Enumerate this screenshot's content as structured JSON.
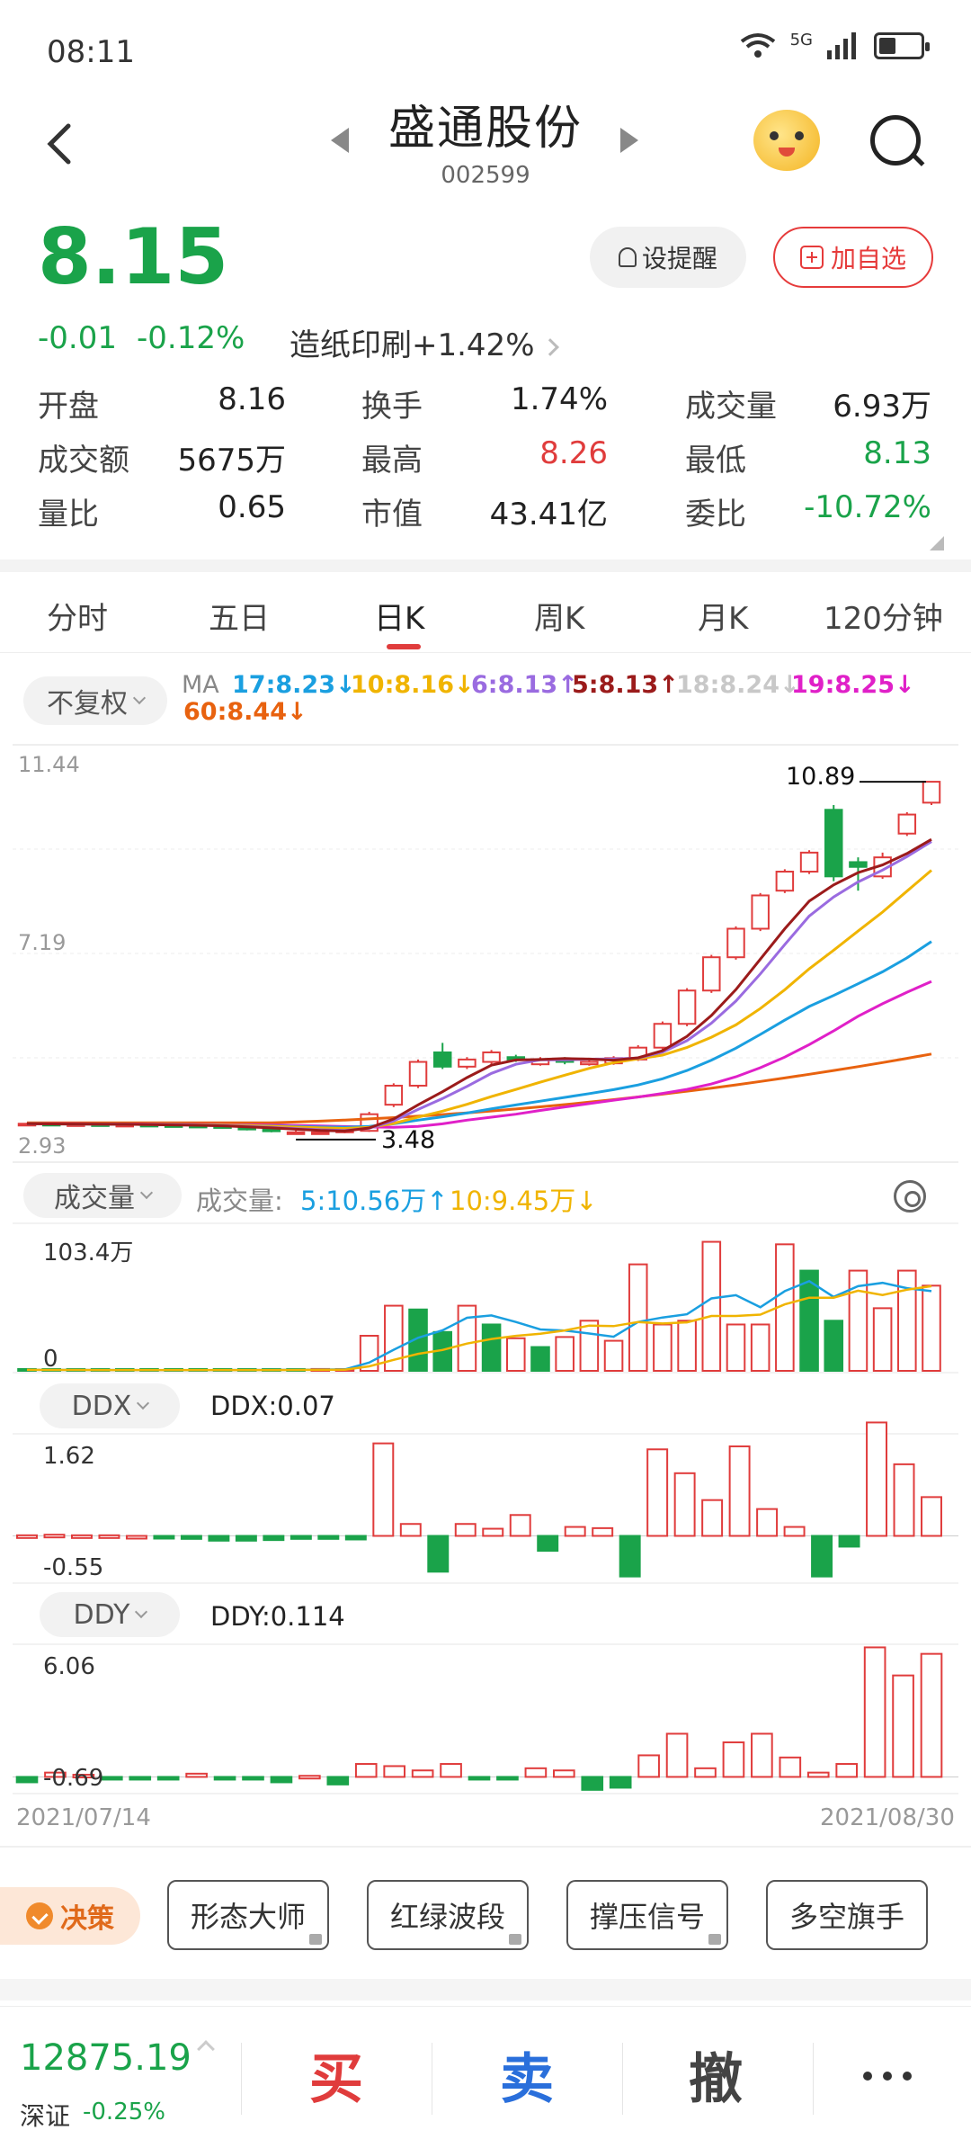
{
  "status": {
    "time": "08:11",
    "network": "5G"
  },
  "header": {
    "title": "盛通股份",
    "code": "002599"
  },
  "quote": {
    "price": "8.15",
    "change": "-0.01",
    "change_pct": "-0.12%",
    "sector_name": "造纸印刷",
    "sector_pct": "+1.42%",
    "remind_label": "设提醒",
    "add_label": "加自选",
    "stats": [
      {
        "label": "开盘",
        "value": "8.16"
      },
      {
        "label": "换手",
        "value": "1.74%"
      },
      {
        "label": "成交量",
        "value": "6.93万"
      },
      {
        "label": "成交额",
        "value": "5675万"
      },
      {
        "label": "最高",
        "value": "8.26"
      },
      {
        "label": "最低",
        "value": "8.13"
      },
      {
        "label": "量比",
        "value": "0.65"
      },
      {
        "label": "市值",
        "value": "43.41亿"
      },
      {
        "label": "委比",
        "value": "-10.72%"
      }
    ]
  },
  "tabs": [
    "分时",
    "五日",
    "日K",
    "周K",
    "月K",
    "120分钟"
  ],
  "kline": {
    "adjust_label": "不复权",
    "ma": [
      {
        "text": "MA",
        "color": "#888888"
      },
      {
        "text": "17:8.23↓",
        "color": "#1a9fe0"
      },
      {
        "text": "10:8.16↓",
        "color": "#f0b400"
      },
      {
        "text": "6:8.13↑",
        "color": "#9a6be0"
      },
      {
        "text": "5:8.13↑",
        "color": "#9b1b1b"
      },
      {
        "text": "18:8.24↓",
        "color": "#c8c8c8"
      },
      {
        "text": "19:8.25↓",
        "color": "#e020c8"
      },
      {
        "text": "60:8.44↓",
        "color": "#e8620f"
      }
    ],
    "y_top": "11.44",
    "y_mid": "7.19",
    "y_bot": "2.93",
    "high_mark": "10.89",
    "low_mark": "3.48"
  },
  "volume": {
    "pill": "成交量",
    "label": "成交量:",
    "ma5": "5:10.56万↑",
    "ma10": "10:9.45万↓",
    "y_top": "103.4万",
    "y_bot": "0"
  },
  "ddx": {
    "pill": "DDX",
    "value_label": "DDX:0.07",
    "y_top": "1.62",
    "y_bot": "-0.55"
  },
  "ddy": {
    "pill": "DDY",
    "value_label": "DDY:0.114",
    "y_top": "6.06",
    "y_bot": "-0.69"
  },
  "dates": {
    "start": "2021/07/14",
    "end": "2021/08/30"
  },
  "tools": {
    "decide": "决策",
    "items": [
      "形态大师",
      "红绿波段",
      "撑压信号",
      "多空旗手"
    ]
  },
  "bottom": {
    "index_value": "12875.19",
    "index_name": "深证",
    "index_change": "-0.25%",
    "buy": "买",
    "sell": "卖",
    "cancel": "撤"
  },
  "chart_data": [
    {
      "type": "candlestick",
      "title": "日K",
      "ylim": [
        2.93,
        11.44
      ],
      "x_range": [
        "2021/07/14",
        "2021/08/30"
      ],
      "open": [
        3.7,
        3.7,
        3.69,
        3.69,
        3.68,
        3.68,
        3.67,
        3.66,
        3.65,
        3.62,
        3.58,
        3.52,
        3.5,
        3.52,
        3.55,
        4.1,
        4.5,
        5.2,
        4.9,
        5.0,
        5.1,
        4.95,
        5.05,
        4.95,
        4.97,
        5.05,
        5.3,
        5.8,
        6.5,
        7.2,
        7.8,
        8.6,
        9.0,
        10.3,
        9.2,
        8.9,
        9.8,
        10.45
      ],
      "close": [
        3.7,
        3.69,
        3.69,
        3.68,
        3.68,
        3.67,
        3.66,
        3.65,
        3.62,
        3.58,
        3.55,
        3.52,
        3.52,
        3.56,
        3.9,
        4.5,
        5.0,
        4.9,
        5.05,
        5.2,
        5.05,
        5.05,
        5.0,
        5.0,
        5.08,
        5.3,
        5.8,
        6.5,
        7.2,
        7.8,
        8.5,
        9.0,
        9.4,
        8.9,
        9.1,
        9.3,
        10.2,
        10.89
      ],
      "high": [
        3.72,
        3.71,
        3.7,
        3.7,
        3.69,
        3.69,
        3.68,
        3.67,
        3.66,
        3.63,
        3.6,
        3.56,
        3.54,
        3.6,
        3.95,
        4.55,
        5.05,
        5.4,
        5.1,
        5.25,
        5.15,
        5.1,
        5.1,
        5.05,
        5.12,
        5.35,
        5.85,
        6.55,
        7.25,
        7.85,
        8.55,
        9.05,
        9.45,
        10.4,
        9.3,
        9.4,
        10.25,
        10.89
      ],
      "low": [
        3.68,
        3.68,
        3.67,
        3.67,
        3.66,
        3.66,
        3.65,
        3.64,
        3.6,
        3.56,
        3.52,
        3.48,
        3.49,
        3.5,
        3.53,
        4.05,
        4.45,
        4.85,
        4.85,
        4.95,
        5.0,
        4.92,
        4.95,
        4.92,
        4.94,
        5.02,
        5.25,
        5.75,
        6.45,
        7.15,
        7.75,
        8.55,
        8.95,
        8.8,
        8.6,
        8.85,
        9.75,
        10.4
      ]
    },
    {
      "type": "bar",
      "title": "成交量",
      "ylim": [
        0,
        103.4
      ],
      "unit": "万",
      "values": [
        0.8,
        0.7,
        0.6,
        0.6,
        0.5,
        0.6,
        0.6,
        0.5,
        0.7,
        0.8,
        1.0,
        1.1,
        1.5,
        1.4,
        28,
        52,
        49,
        31,
        52,
        37,
        26,
        19,
        27,
        40,
        24,
        85,
        37,
        40,
        103,
        37,
        37,
        101,
        80,
        40,
        80,
        50,
        80,
        68
      ],
      "up": [
        0,
        0,
        0,
        0,
        0,
        0,
        0,
        0,
        0,
        0,
        0,
        0,
        1,
        1,
        1,
        1,
        0,
        0,
        1,
        0,
        1,
        0,
        1,
        1,
        1,
        1,
        1,
        1,
        1,
        1,
        1,
        1,
        0,
        0,
        1,
        1,
        1,
        1
      ]
    },
    {
      "type": "bar",
      "title": "DDX",
      "ylim": [
        -0.55,
        1.62
      ],
      "values": [
        0.01,
        0.02,
        0.01,
        0.01,
        0,
        -0.02,
        -0.05,
        -0.08,
        -0.08,
        -0.07,
        -0.05,
        -0.05,
        -0.06,
        1.55,
        0.2,
        -0.6,
        0.2,
        0.12,
        0.35,
        -0.25,
        0.15,
        0.13,
        -0.68,
        1.45,
        1.05,
        0.6,
        1.5,
        0.45,
        0.15,
        -0.68,
        -0.18,
        1.9,
        1.2,
        0.65
      ],
      "up": [
        1,
        1,
        1,
        1,
        1,
        0,
        0,
        0,
        0,
        0,
        0,
        0,
        0,
        1,
        1,
        0,
        1,
        1,
        1,
        0,
        1,
        1,
        0,
        1,
        1,
        1,
        1,
        1,
        1,
        0,
        0,
        1,
        1,
        1
      ]
    },
    {
      "type": "bar",
      "title": "DDY",
      "ylim": [
        -0.69,
        6.06
      ],
      "values": [
        -0.25,
        0.2,
        0.1,
        -0.12,
        -0.05,
        -0.05,
        0.15,
        -0.05,
        -0.05,
        -0.25,
        0.05,
        -0.35,
        0.6,
        0.5,
        0.3,
        0.6,
        -0.05,
        -0.05,
        0.4,
        0.3,
        -0.6,
        -0.5,
        1.0,
        2.0,
        0.4,
        1.6,
        2.0,
        0.9,
        0.2,
        0.6,
        6.0,
        4.7,
        5.7
      ],
      "up": [
        0,
        1,
        1,
        0,
        0,
        0,
        1,
        0,
        0,
        0,
        1,
        0,
        1,
        1,
        1,
        1,
        0,
        0,
        1,
        1,
        0,
        0,
        1,
        1,
        1,
        1,
        1,
        1,
        1,
        1,
        1,
        1,
        1
      ]
    }
  ]
}
